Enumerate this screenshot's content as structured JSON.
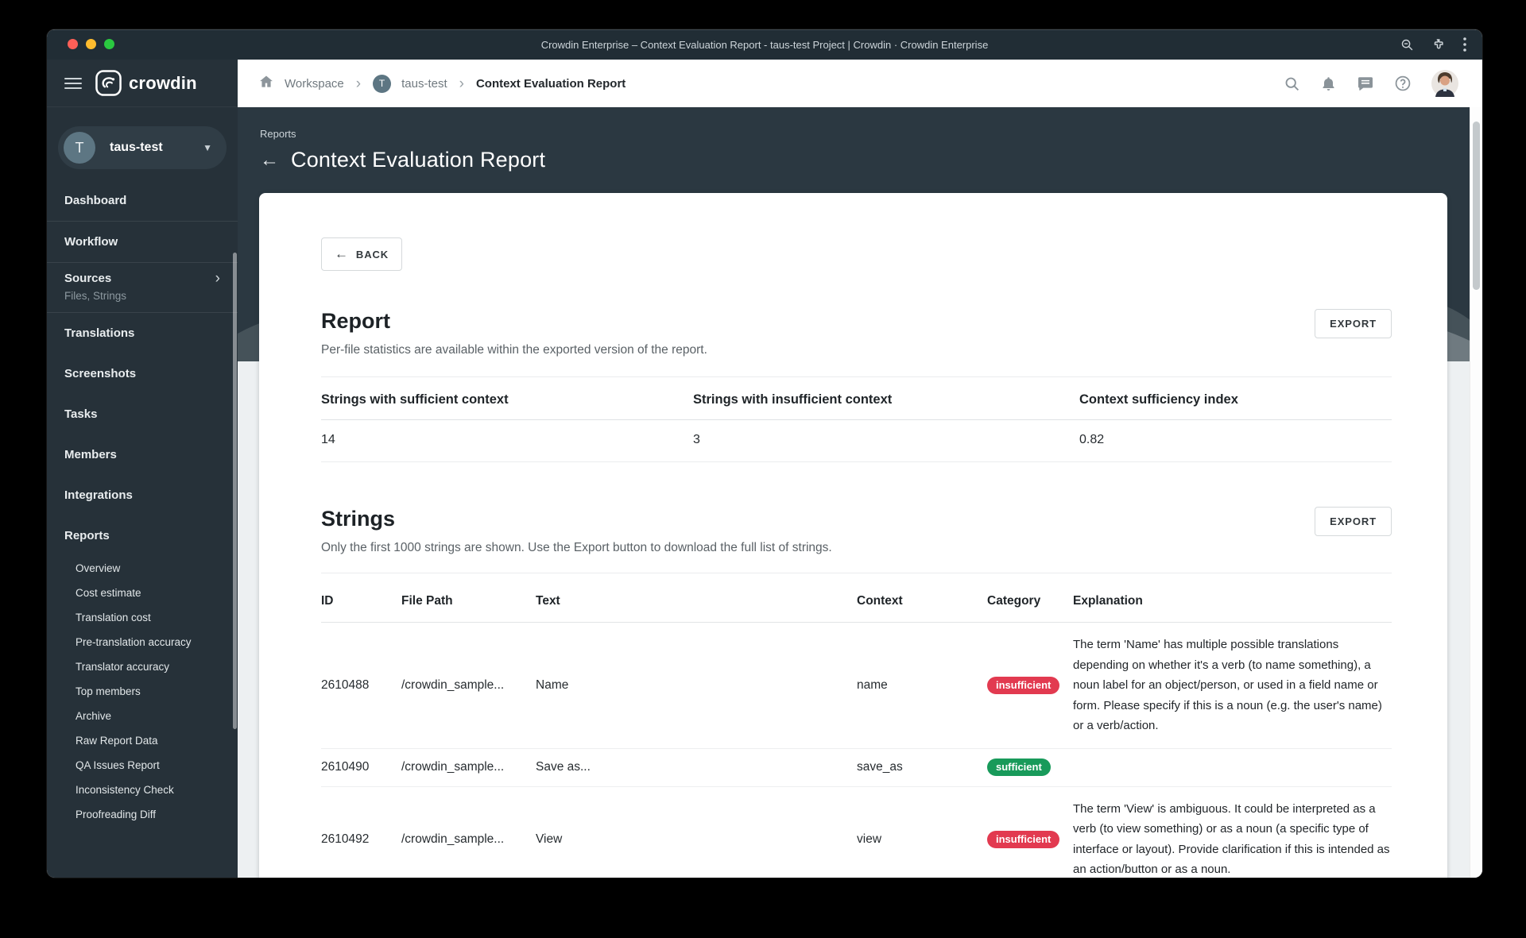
{
  "browser": {
    "window_title": "Crowdin Enterprise – Context Evaluation Report - taus-test Project | Crowdin · Crowdin Enterprise"
  },
  "topbar": {
    "breadcrumb": {
      "workspace": "Workspace",
      "project_initial": "T",
      "project": "taus-test",
      "current": "Context Evaluation Report"
    }
  },
  "sidebar": {
    "brand": "crowdin",
    "project_switcher": {
      "initial": "T",
      "name": "taus-test"
    },
    "nav": [
      {
        "label": "Dashboard",
        "divider_after": true
      },
      {
        "label": "Workflow",
        "divider_after": true
      },
      {
        "label": "Sources",
        "subtitle": "Files, Strings",
        "chevron": true,
        "divider_after": true
      },
      {
        "label": "Translations"
      },
      {
        "label": "Screenshots"
      },
      {
        "label": "Tasks"
      },
      {
        "label": "Members"
      },
      {
        "label": "Integrations"
      },
      {
        "label": "Reports"
      }
    ],
    "reports_subitems": [
      "Overview",
      "Cost estimate",
      "Translation cost",
      "Pre-translation accuracy",
      "Translator accuracy",
      "Top members",
      "Archive",
      "Raw Report Data",
      "QA Issues Report",
      "Inconsistency Check",
      "Proofreading Diff"
    ]
  },
  "page": {
    "eyebrow": "Reports",
    "title": "Context Evaluation Report",
    "back_button": "BACK"
  },
  "report_section": {
    "heading": "Report",
    "subtitle": "Per-file statistics are available within the exported version of the report.",
    "export_button": "EXPORT",
    "stats_headers": [
      "Strings with sufficient context",
      "Strings with insufficient context",
      "Context sufficiency index"
    ],
    "stats_values": [
      "14",
      "3",
      "0.82"
    ]
  },
  "strings_section": {
    "heading": "Strings",
    "subtitle": "Only the first 1000 strings are shown. Use the Export button to download the full list of strings.",
    "export_button": "EXPORT",
    "columns": [
      "ID",
      "File Path",
      "Text",
      "Context",
      "Category",
      "Explanation"
    ],
    "rows": [
      {
        "id": "2610488",
        "file_path": "/crowdin_sample...",
        "text": "Name",
        "context": "name",
        "category": "insufficient",
        "explanation": "The term 'Name' has multiple possible translations depending on whether it's a verb (to name something), a noun label for an object/person, or used in a field name or form. Please specify if this is a noun (e.g. the user's name) or a verb/action."
      },
      {
        "id": "2610490",
        "file_path": "/crowdin_sample...",
        "text": "Save as...",
        "context": "save_as",
        "category": "sufficient",
        "explanation": ""
      },
      {
        "id": "2610492",
        "file_path": "/crowdin_sample...",
        "text": "View",
        "context": "view",
        "category": "insufficient",
        "explanation": "The term 'View' is ambiguous. It could be interpreted as a verb (to view something) or as a noun (a specific type of interface or layout). Provide clarification if this is intended as an action/button or as a noun."
      }
    ]
  },
  "colors": {
    "titlebar_bg": "#212d35",
    "sidebar_bg": "#263139",
    "header_band_bg": "#2b3841",
    "page_bg": "#edf0f2",
    "badge_insufficient": "#e23a50",
    "badge_sufficient": "#189a5a",
    "avatar_bg": "#5d7683"
  }
}
